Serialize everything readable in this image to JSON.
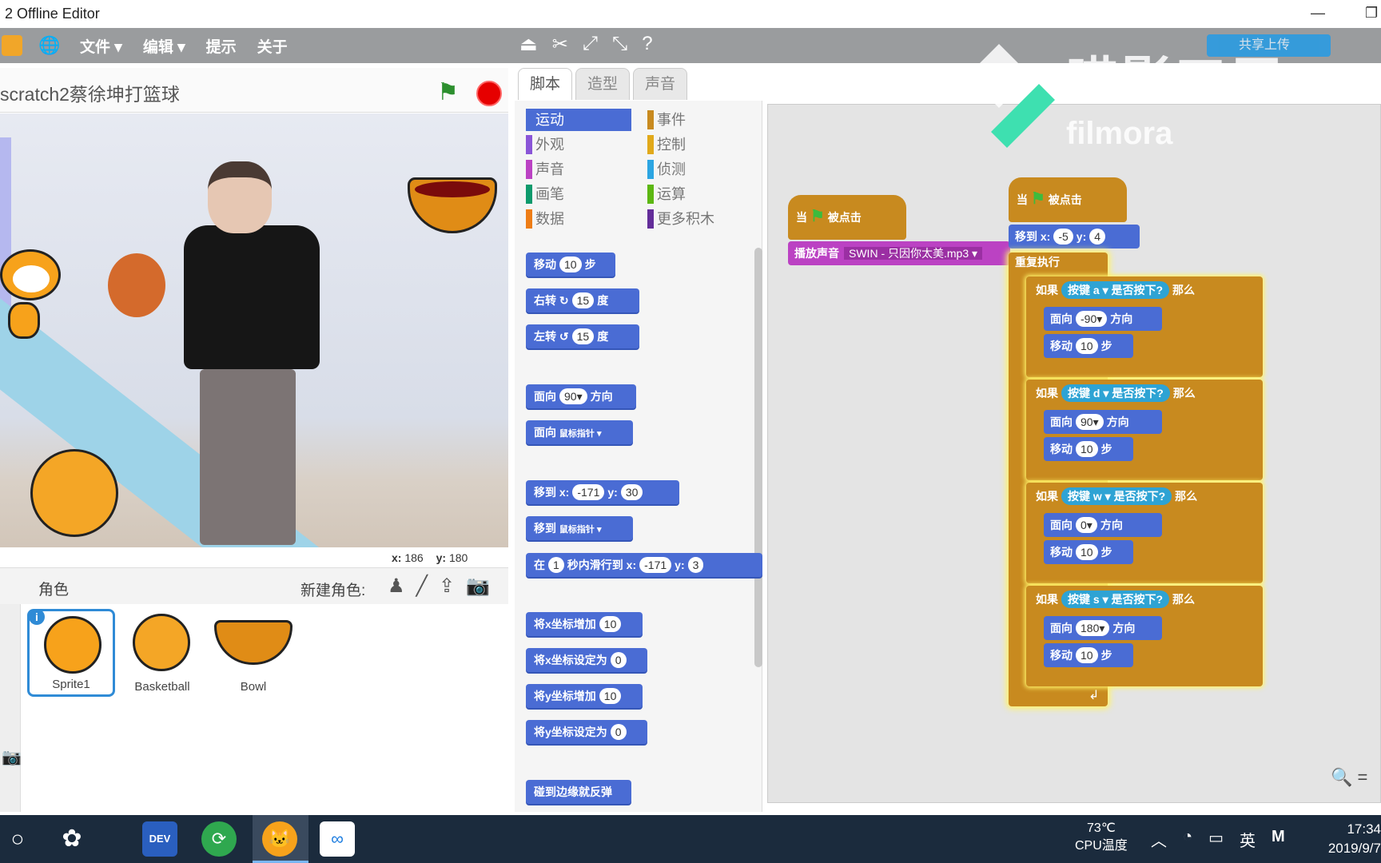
{
  "window": {
    "title": "2 Offline Editor",
    "minimize": "—",
    "restore": "❐"
  },
  "menu": {
    "file": "文件 ▾",
    "edit": "编辑 ▾",
    "tips": "提示",
    "about": "关于"
  },
  "upload": {
    "label": "共享上传"
  },
  "stage": {
    "project_title": "scratch2蔡徐坤打篮球",
    "coord_x_label": "x:",
    "coord_x": "186",
    "coord_y_label": "y:",
    "coord_y": "180"
  },
  "sprites": {
    "header": "角色",
    "new_sprite": "新建角色:",
    "items": [
      {
        "name": "Sprite1",
        "selected": true
      },
      {
        "name": "Basketball",
        "selected": false
      },
      {
        "name": "Bowl",
        "selected": false
      }
    ]
  },
  "tabs": [
    "脚本",
    "造型",
    "声音"
  ],
  "categories": [
    {
      "label": "运动",
      "color": "#4a6cd4"
    },
    {
      "label": "外观",
      "color": "#8a55d7"
    },
    {
      "label": "声音",
      "color": "#bb42c3"
    },
    {
      "label": "画笔",
      "color": "#0e9a6c"
    },
    {
      "label": "数据",
      "color": "#ee7d16"
    },
    {
      "label": "事件",
      "color": "#c88a1f"
    },
    {
      "label": "控制",
      "color": "#e1a91a"
    },
    {
      "label": "侦测",
      "color": "#2ca5e2"
    },
    {
      "label": "运算",
      "color": "#5cb712"
    },
    {
      "label": "更多积木",
      "color": "#632d99"
    }
  ],
  "palette_blocks": {
    "move": {
      "pre": "移动",
      "val": "10",
      "post": "步"
    },
    "turn_right": {
      "pre": "右转 ↻",
      "val": "15",
      "post": "度"
    },
    "turn_left": {
      "pre": "左转 ↺",
      "val": "15",
      "post": "度"
    },
    "point_dir": {
      "pre": "面向",
      "val": "90▾",
      "post": "方向"
    },
    "point_towards": {
      "pre": "面向",
      "val": "鼠标指针 ▾"
    },
    "goto_xy": {
      "pre": "移到 x:",
      "x": "-171",
      "mid": "y:",
      "y": "30"
    },
    "goto": {
      "pre": "移到",
      "val": "鼠标指针 ▾"
    },
    "glide": {
      "pre": "在",
      "val": "1",
      "mid": "秒内滑行到 x:",
      "x": "-171",
      "mid2": "y:",
      "y": "3"
    },
    "change_x": {
      "pre": "将x坐标增加",
      "val": "10"
    },
    "set_x": {
      "pre": "将x坐标设定为",
      "val": "0"
    },
    "change_y": {
      "pre": "将y坐标增加",
      "val": "10"
    },
    "set_y": {
      "pre": "将y坐标设定为",
      "val": "0"
    },
    "bounce": {
      "label": "碰到边缘就反弹"
    }
  },
  "script1": {
    "hat": {
      "pre": "当",
      "post": "被点击"
    },
    "sound": {
      "pre": "播放声音",
      "val": "SWIN - 只因你太美.mp3 ▾"
    }
  },
  "script2": {
    "hat": {
      "pre": "当",
      "post": "被点击"
    },
    "goto": {
      "pre": "移到 x:",
      "x": "-5",
      "mid": "y:",
      "y": "4"
    },
    "forever": "重复执行",
    "if1": {
      "pre": "如果",
      "key_pre": "按键",
      "key": "a ▾",
      "key_post": "是否按下?",
      "post": "那么",
      "dir": "-90▾",
      "steps": "10"
    },
    "if2": {
      "pre": "如果",
      "key_pre": "按键",
      "key": "d ▾",
      "key_post": "是否按下?",
      "post": "那么",
      "dir": "90▾",
      "steps": "10"
    },
    "if3": {
      "pre": "如果",
      "key_pre": "按键",
      "key": "w ▾",
      "key_post": "是否按下?",
      "post": "那么",
      "dir": "0▾",
      "steps": "10"
    },
    "if4": {
      "pre": "如果",
      "key_pre": "按键",
      "key": "s ▾",
      "key_post": "是否按下?",
      "post": "那么",
      "dir": "180▾",
      "steps": "10"
    },
    "face_pre": "面向",
    "face_post": "方向",
    "move_pre": "移动",
    "move_post": "步"
  },
  "watermark": {
    "brand_cn": "喵影工厂",
    "brand_en": "filmora"
  },
  "taskbar": {
    "temp": "73℃",
    "temp_label": "CPU温度",
    "ime": "英",
    "time": "17:34",
    "date": "2019/9/7"
  }
}
